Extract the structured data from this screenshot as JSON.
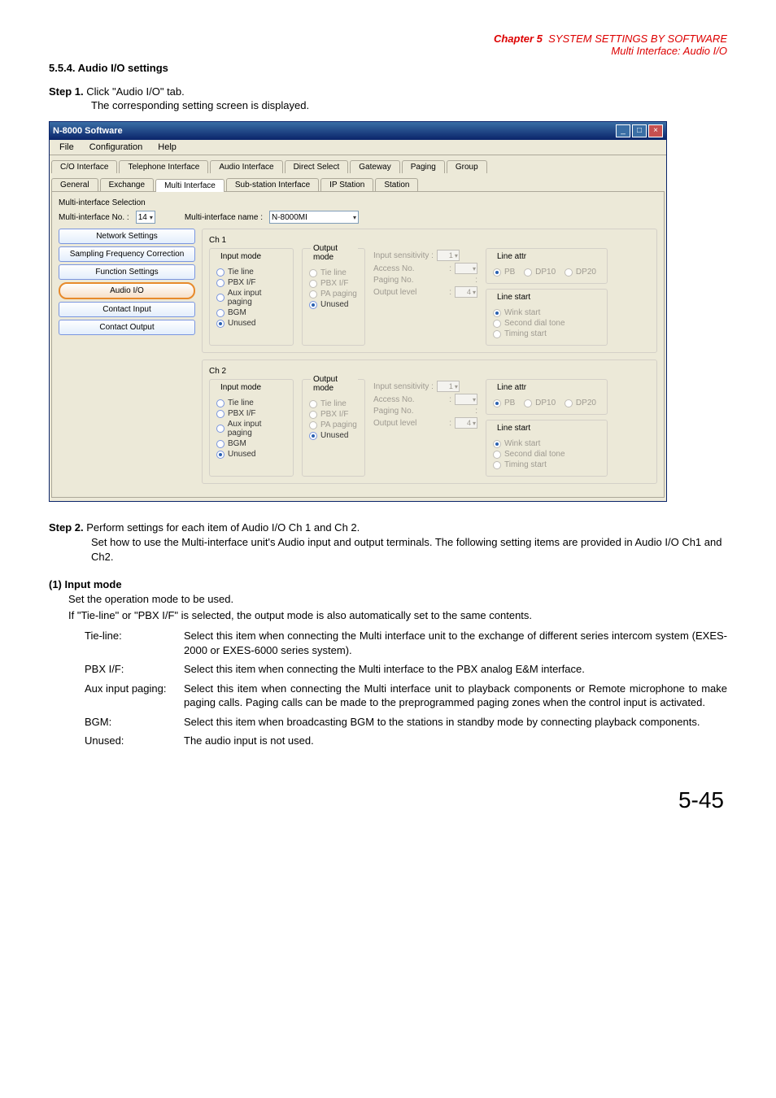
{
  "chapter": {
    "label": "Chapter 5",
    "title_rest": "SYSTEM SETTINGS BY SOFTWARE",
    "subtitle": "Multi Interface: Audio I/O"
  },
  "section_heading": "5.5.4. Audio I/O settings",
  "step1": {
    "label": "Step 1.",
    "text": "Click \"Audio I/O\" tab.",
    "desc": "The corresponding setting screen is displayed."
  },
  "app": {
    "title": "N-8000 Software",
    "menu": {
      "file": "File",
      "config": "Configuration",
      "help": "Help"
    },
    "tabs": {
      "row1": [
        "C/O Interface",
        "Telephone Interface",
        "Audio Interface",
        "Direct Select",
        "Gateway",
        "Paging",
        "Group"
      ],
      "row2": [
        "General",
        "Exchange",
        "Multi Interface",
        "Sub-station Interface",
        "IP Station",
        "Station"
      ]
    },
    "topcontrols": {
      "label1": "Multi-interface No. :",
      "val1": "14",
      "label2": "Multi-interface name :",
      "val2": "N-8000MI"
    },
    "section_label": "Multi-interface Selection",
    "leftnav": [
      "Network Settings",
      "Sampling Frequency Correction",
      "Function Settings",
      "Audio I/O",
      "Contact Input",
      "Contact Output"
    ],
    "ch": {
      "ch1": "Ch 1",
      "ch2": "Ch 2",
      "input_mode": "Input mode",
      "output_mode": "Output mode",
      "tie": "Tie line",
      "pbx": "PBX I/F",
      "aux": "Aux input paging",
      "bgm": "BGM",
      "unused": "Unused",
      "pa": "PA paging",
      "in_sens": "Input sensitivity :",
      "access": "Access No.",
      "paging": "Paging No.",
      "outlvl": "Output level",
      "line_attr": "Line attr",
      "pb": "PB",
      "dp10": "DP10",
      "dp20": "DP20",
      "line_start": "Line start",
      "wink": "Wink start",
      "second": "Second dial tone",
      "timing": "Timing start",
      "val1": "1",
      "val4": "4",
      "colon": ":"
    }
  },
  "step2": {
    "label": "Step 2.",
    "text": "Perform settings for each item of Audio I/O Ch 1 and Ch 2.",
    "p1": "Set how to use the Multi-interface unit's Audio input and output terminals. The following setting items are provided in Audio I/O Ch1 and Ch2."
  },
  "input_mode": {
    "heading": "(1)  Input mode",
    "p1": "Set the operation mode to be used.",
    "p2": "If \"Tie-line\" or \"PBX I/F\" is selected, the output mode is also automatically set to the same contents.",
    "rows": {
      "tie": {
        "term": "Tie-line:",
        "desc": "Select this item when connecting the Multi interface unit to the exchange of different series intercom system (EXES-2000 or EXES-6000 series system)."
      },
      "pbx": {
        "term": "PBX I/F:",
        "desc": "Select this item when connecting the Multi interface to the PBX analog E&M interface."
      },
      "aux": {
        "term": "Aux input paging:",
        "desc": "Select this item when connecting the Multi interface unit to playback components or Remote microphone to make paging calls. Paging calls can be made to the preprogrammed paging zones when the control input is activated."
      },
      "bgm": {
        "term": "BGM:",
        "desc": "Select this item when broadcasting BGM to the stations in standby mode by connecting playback components."
      },
      "unused": {
        "term": "Unused:",
        "desc": "The audio input is not used."
      }
    }
  },
  "page_number": "5-45"
}
